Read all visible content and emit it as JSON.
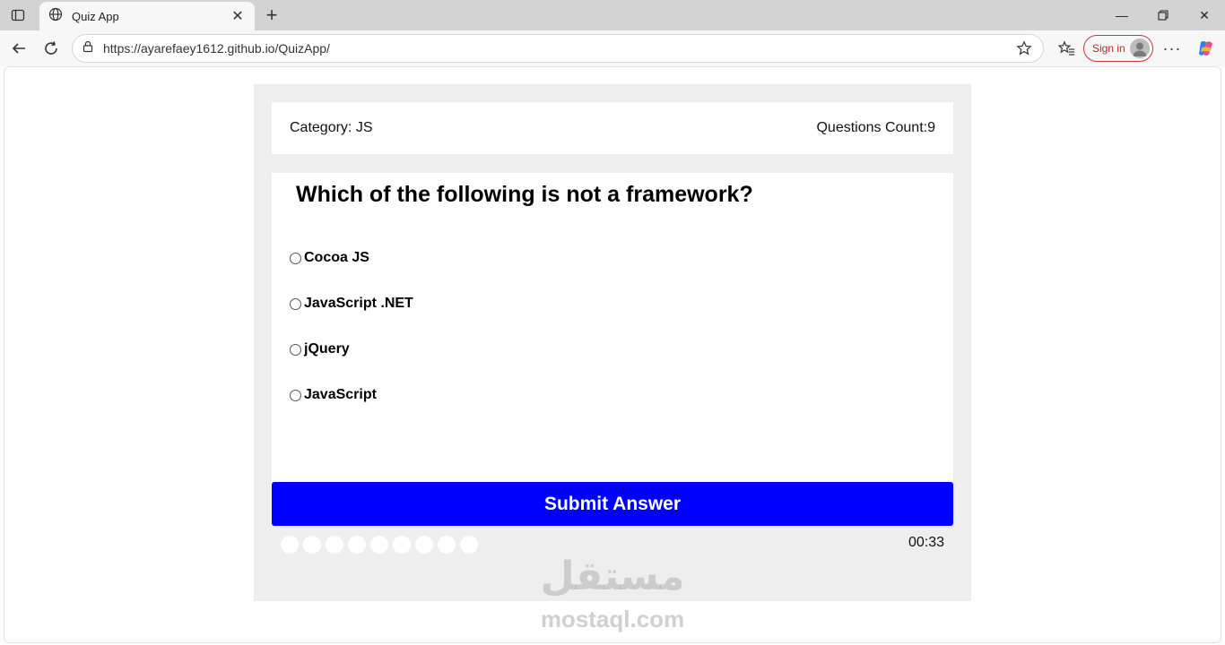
{
  "browser": {
    "tab_title": "Quiz App",
    "url": "https://ayarefaey1612.github.io/QuizApp/",
    "signin_label": "Sign in",
    "icons": [
      "sidebar-toggle-icon",
      "globe-icon",
      "close-icon",
      "plus-icon",
      "minimize-icon",
      "restore-icon",
      "back-icon",
      "reload-icon",
      "lock-icon",
      "star-icon",
      "favorites-icon",
      "more-icon",
      "copilot-icon"
    ]
  },
  "quiz": {
    "category_label": "Category: JS",
    "questions_count_label": "Questions Count:9",
    "question": "Which of the following is not a framework?",
    "answers": [
      {
        "label": "Cocoa JS"
      },
      {
        "label": "JavaScript .NET"
      },
      {
        "label": "jQuery"
      },
      {
        "label": "JavaScript"
      }
    ],
    "submit_label": "Submit Answer",
    "bullets_count": 9,
    "timer": "00:33",
    "accent_color": "#0000ff",
    "panel_color": "#eeeeee"
  },
  "watermark": {
    "logo_text": "مستقل",
    "site": "mostaql.com"
  }
}
